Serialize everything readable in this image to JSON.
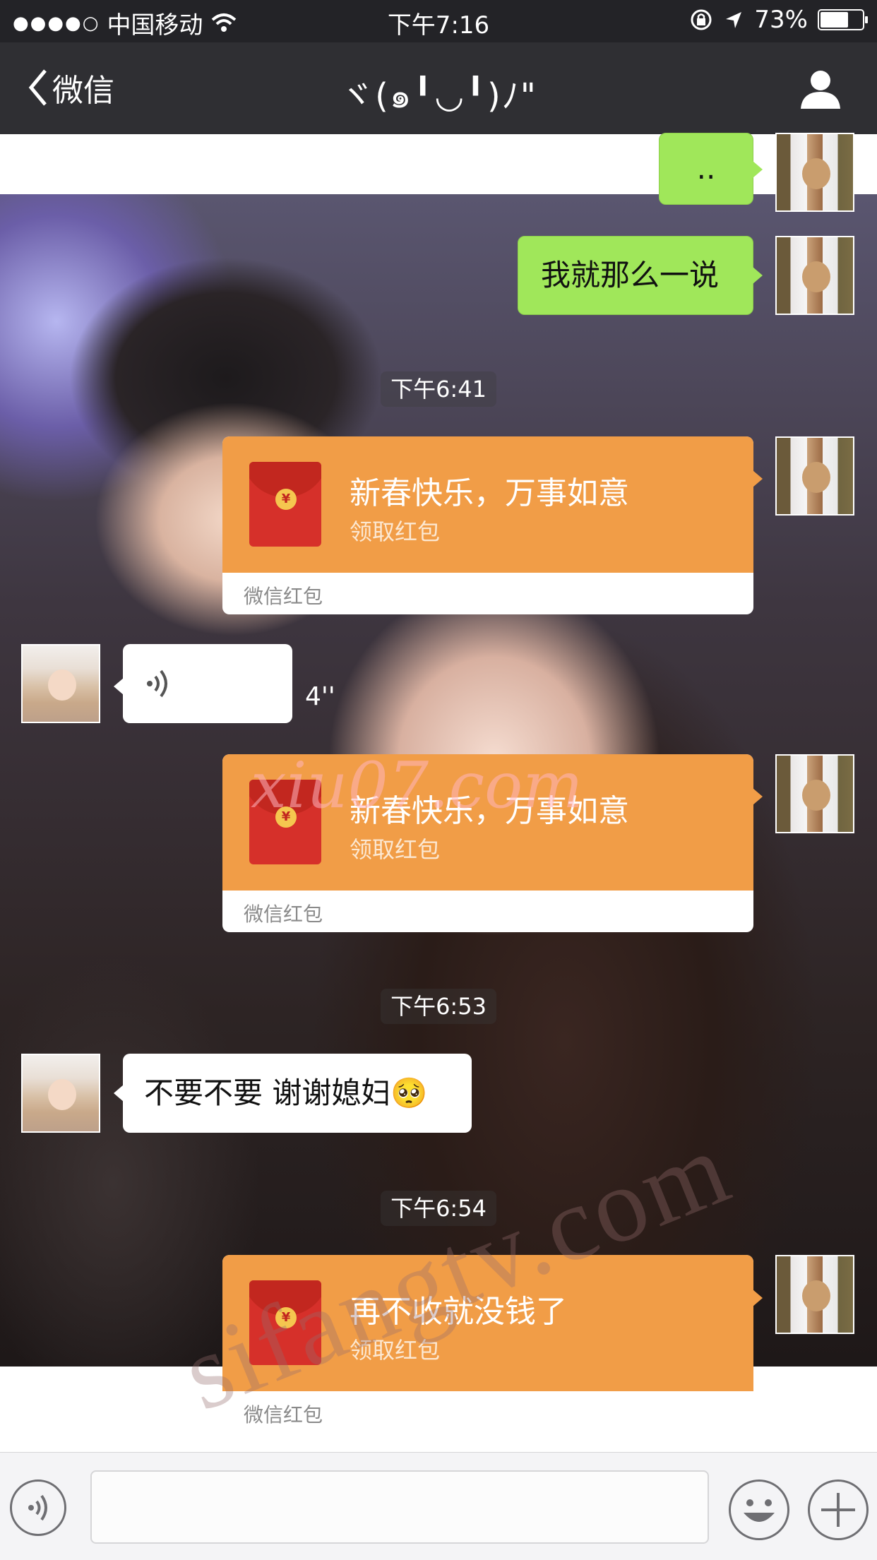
{
  "status_bar": {
    "signal_dots": "●●●●○",
    "carrier": "中国移动",
    "time": "下午7:16",
    "battery_percent_label": "73%",
    "battery_level": 0.73
  },
  "nav": {
    "back_label": "微信",
    "title": "ヾ(๑╹◡╹)ﾉ\""
  },
  "messages": {
    "m1_text": "..",
    "m2_text": "我就那么一说",
    "ts1": "下午6:41",
    "rp1_title": "新春快乐，万事如意",
    "rp1_sub": "领取红包",
    "rp1_footer": "微信红包",
    "voice_duration": "4''",
    "rp2_title": "新春快乐，万事如意",
    "rp2_sub": "领取红包",
    "rp2_footer": "微信红包",
    "ts2": "下午6:53",
    "m3_text": "不要不要 谢谢媳妇🥺",
    "ts3": "下午6:54",
    "rp3_title": "再不收就没钱了",
    "rp3_sub": "领取红包",
    "rp3_footer": "微信红包"
  },
  "watermarks": {
    "w1": "xiu07.com",
    "w2": "sifangtv.com"
  },
  "icons": {
    "coin_symbol": "¥"
  },
  "colors": {
    "my_bubble": "#a0e75a",
    "red_packet": "#f19d47",
    "nav_bg": "#2f2f33"
  }
}
